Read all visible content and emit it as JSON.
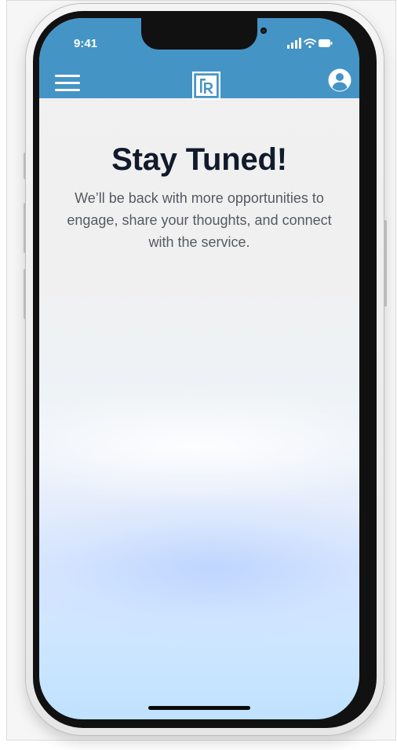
{
  "status_bar": {
    "time": "9:41",
    "icons": [
      "signal-icon",
      "wifi-icon",
      "battery-icon"
    ]
  },
  "header": {
    "background_color": "#4594c6",
    "menu_icon": "hamburger-menu-icon",
    "logo_icon": "r-logo-icon",
    "profile_icon": "user-profile-icon"
  },
  "main": {
    "title": "Stay Tuned!",
    "message": "We’ll be back with more opportunities to engage, share your thoughts, and connect with the service."
  },
  "colors": {
    "title_color": "#111b2b",
    "message_color": "#555a61",
    "accent": "#4594c6"
  }
}
